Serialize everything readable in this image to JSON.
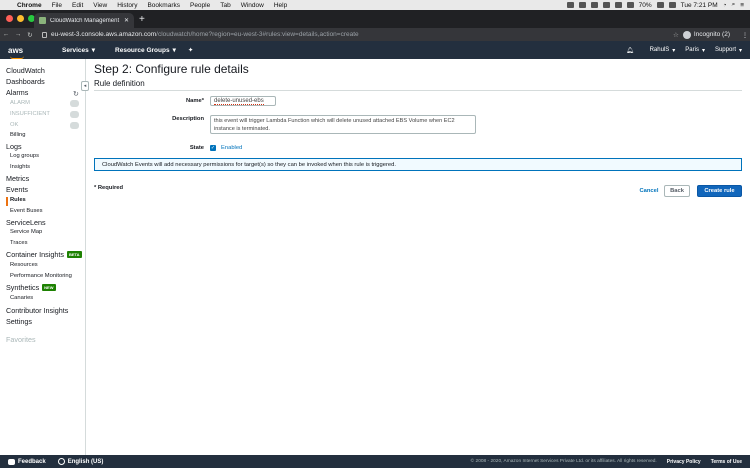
{
  "macos": {
    "menu": [
      "Chrome",
      "File",
      "Edit",
      "View",
      "History",
      "Bookmarks",
      "People",
      "Tab",
      "Window",
      "Help"
    ],
    "battery": "70%",
    "clock": "Tue 7:21 PM"
  },
  "browser": {
    "tab_title": "CloudWatch Management Con",
    "url_host": "eu-west-3.console.aws.amazon.com",
    "url_path": "/cloudwatch/home?region=eu-west-3#rules:view=details,action=create",
    "incognito_label": "Incognito (2)"
  },
  "aws_nav": {
    "logo": "aws",
    "services": "Services",
    "resource_groups": "Resource Groups",
    "user": "RahulS",
    "region": "Paris",
    "support": "Support"
  },
  "sidebar": {
    "cloudwatch": "CloudWatch",
    "dashboards": "Dashboards",
    "alarms": "Alarms",
    "alarm": "ALARM",
    "insufficient": "INSUFFICIENT",
    "ok": "OK",
    "billing": "Billing",
    "logs": "Logs",
    "log_groups": "Log groups",
    "insights": "Insights",
    "metrics": "Metrics",
    "events": "Events",
    "rules": "Rules",
    "event_buses": "Event Buses",
    "servicelens": "ServiceLens",
    "service_map": "Service Map",
    "traces": "Traces",
    "container_insights": "Container Insights",
    "beta_badge": "BETA",
    "resources": "Resources",
    "performance_monitoring": "Performance Monitoring",
    "synthetics": "Synthetics",
    "new_badge": "NEW",
    "canaries": "Canaries",
    "contributor_insights": "Contributor Insights",
    "settings": "Settings",
    "favorites": "Favorites"
  },
  "page": {
    "title": "Step 2: Configure rule details",
    "section": "Rule definition",
    "name_label": "Name*",
    "name_value": "delete-unused-ebs",
    "description_label": "Description",
    "description_value": "this event will trigger Lambda Function which will delete unused attached EBS Volume when EC2 instance is terminated.",
    "state_label": "State",
    "state_value": "Enabled",
    "info": "CloudWatch Events will add necessary permissions for target(s) so they can be invoked when this rule is triggered.",
    "required": "* Required",
    "cancel": "Cancel",
    "back": "Back",
    "create": "Create rule"
  },
  "footer": {
    "feedback": "Feedback",
    "language": "English (US)",
    "copyright": "© 2008 - 2020, Amazon Internet Services Private Ltd. or its affiliates. All rights reserved.",
    "privacy": "Privacy Policy",
    "terms": "Terms of Use"
  }
}
